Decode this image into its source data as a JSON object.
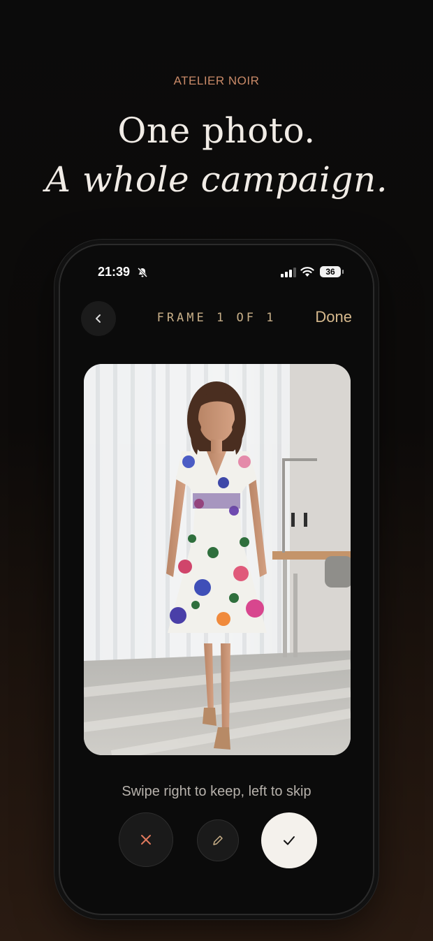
{
  "brand": "ATELIER NOIR",
  "headline": {
    "line1": "One photo.",
    "line2": "A whole campaign."
  },
  "status": {
    "time": "21:39",
    "battery": "36"
  },
  "nav": {
    "frame_label": "FRAME 1 OF 1",
    "done_label": "Done"
  },
  "photo": {
    "subject": "model in floral dress in sewing studio"
  },
  "hint": "Swipe right to keep, left to skip",
  "colors": {
    "accent": "#c98a68",
    "gold": "#d6b98d",
    "skip": "#e0795d"
  },
  "icons": [
    "bell-slash-icon",
    "signal-icon",
    "wifi-icon",
    "battery-icon",
    "chevron-left-icon",
    "close-icon",
    "pencil-icon",
    "check-icon"
  ]
}
